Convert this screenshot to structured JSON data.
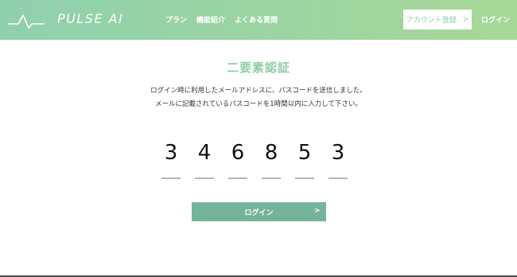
{
  "header": {
    "logo_text": "PULSE AI",
    "nav": [
      "プラン",
      "機能紹介",
      "よくある質問"
    ],
    "signup_label": "アカウント登録",
    "signup_arrow": ">",
    "login_label": "ログイン"
  },
  "main": {
    "title": "二要素認証",
    "description_line1": "ログイン時に利用したメールアドレスに、パスコードを送信しました。",
    "description_line2": "メールに記載されているパスコードを1時間以内に入力して下さい。",
    "code_digits": [
      "3",
      "4",
      "6",
      "8",
      "5",
      "3"
    ],
    "login_button_label": "ログイン",
    "login_button_arrow": ">"
  },
  "colors": {
    "header_gradient_start": "#8fd0ad",
    "header_gradient_end": "#a7d897",
    "accent": "#8fcfa6",
    "button": "#74b49a"
  },
  "icons": {
    "logo": "pulse-waveform-icon",
    "arrow": "chevron-right-icon"
  }
}
